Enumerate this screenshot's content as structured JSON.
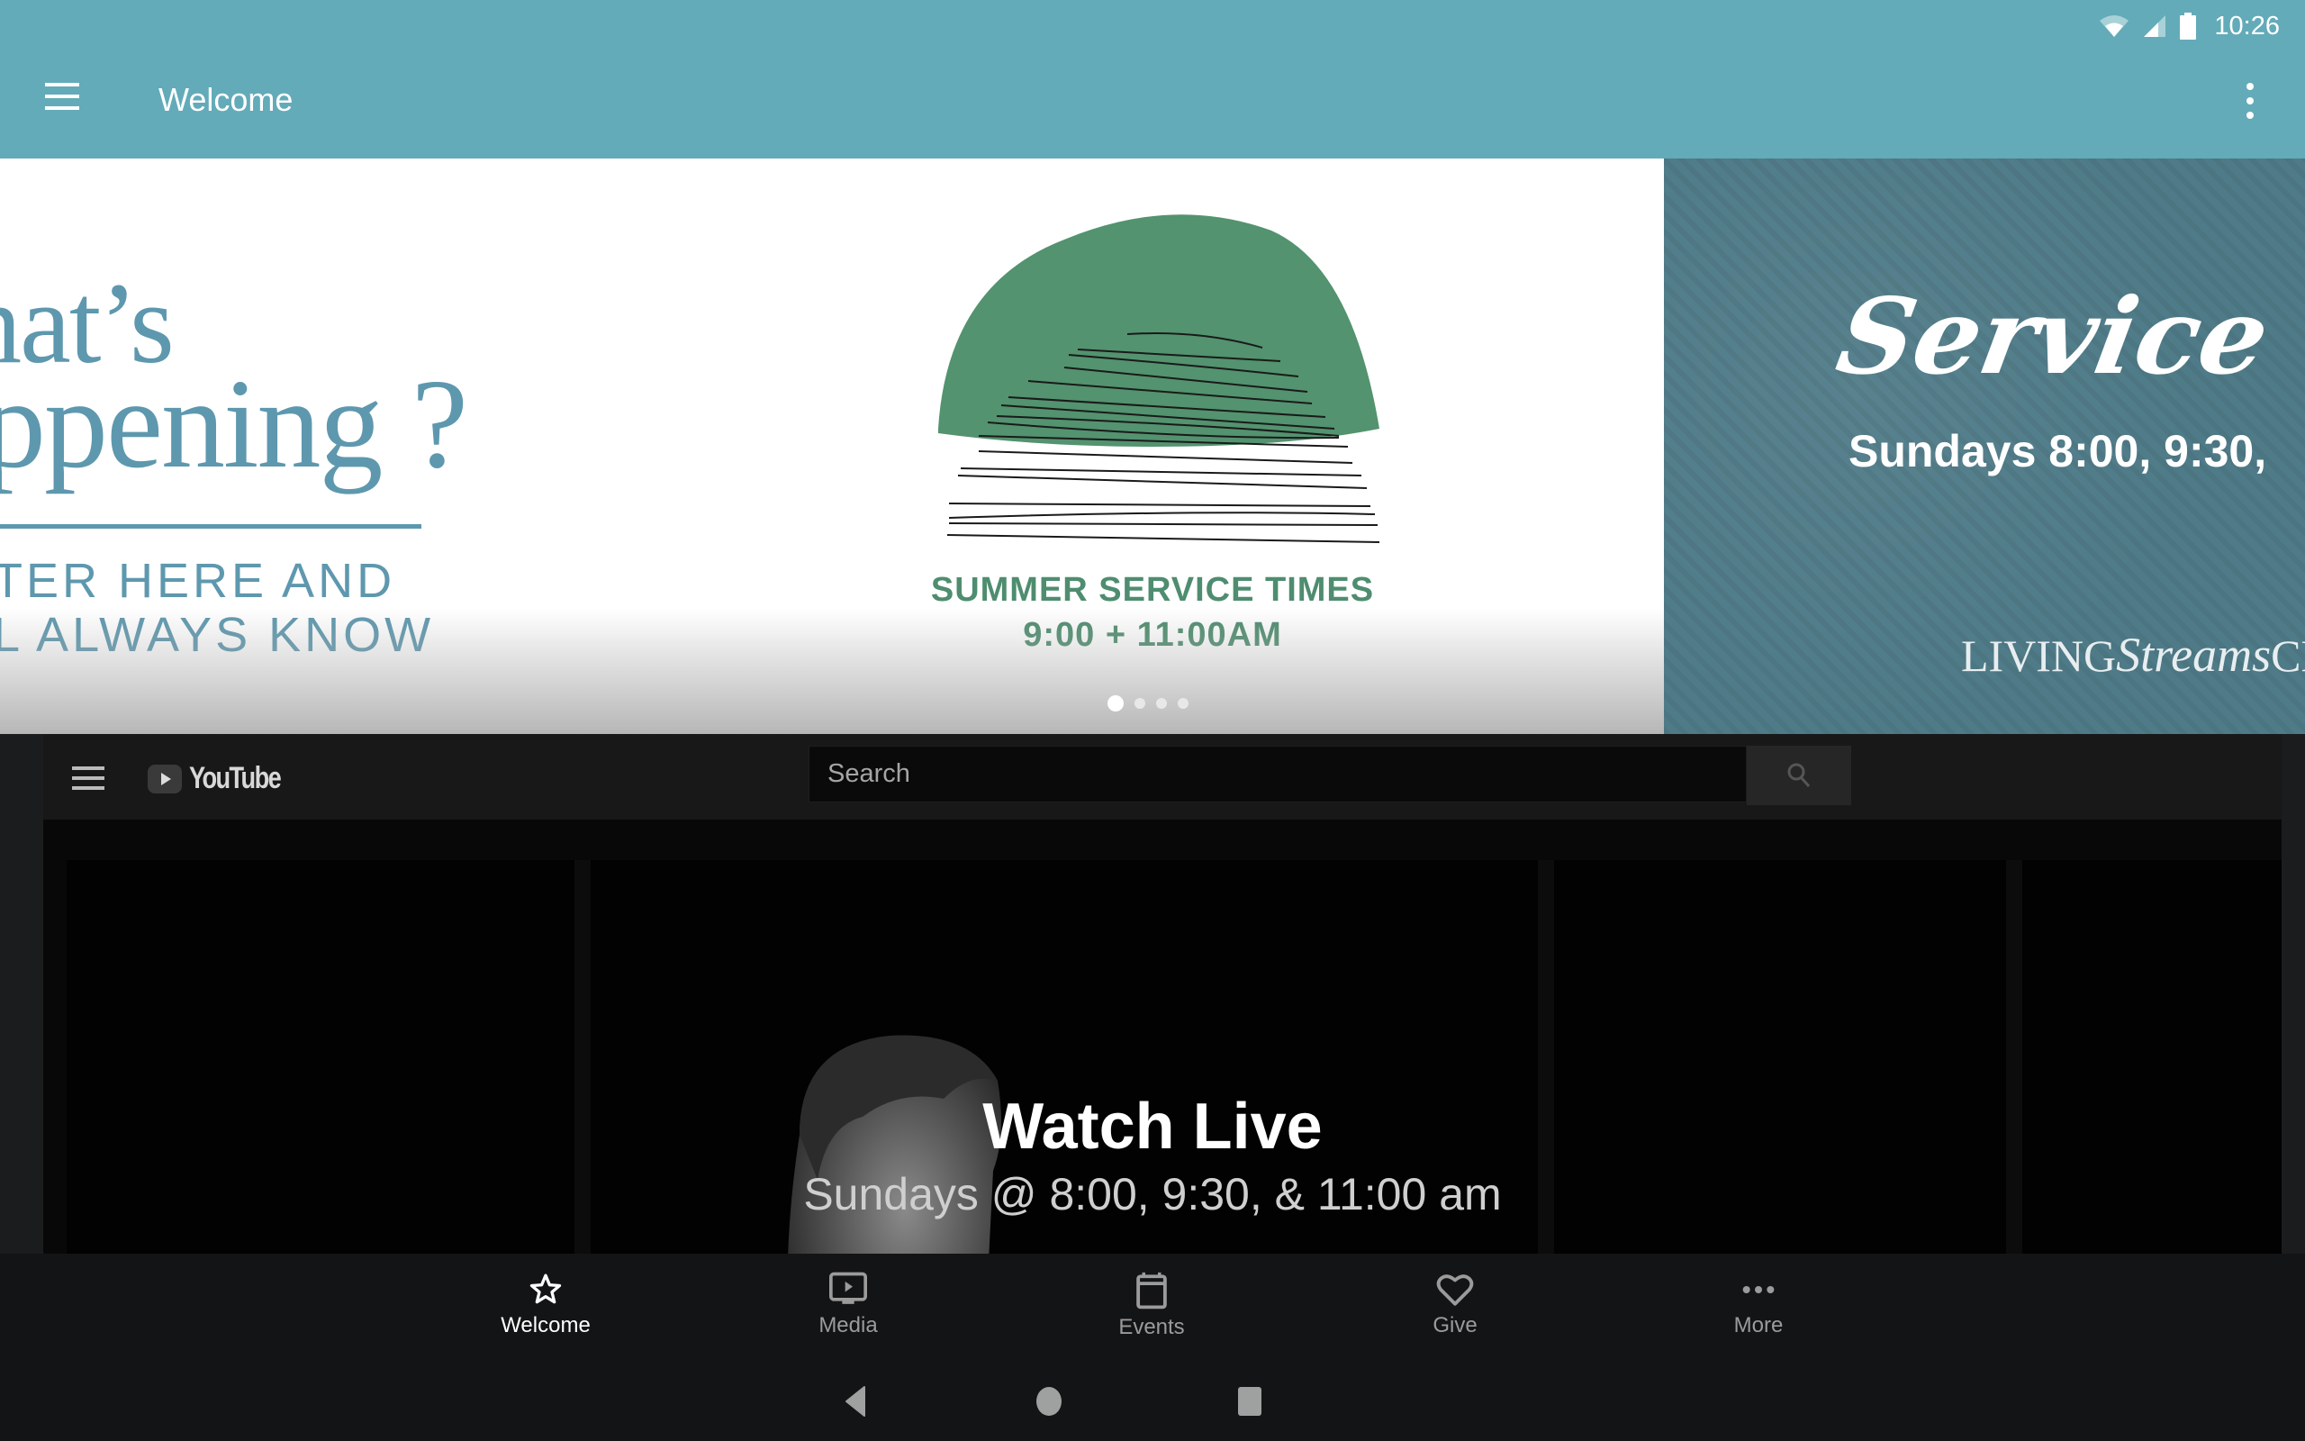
{
  "status_bar": {
    "time": "10:26",
    "icons": [
      "wifi-icon",
      "cell-signal-icon",
      "battery-icon"
    ]
  },
  "app_bar": {
    "menu_icon": "hamburger-menu-icon",
    "title": "Welcome",
    "overflow_icon": "more-vert-icon"
  },
  "carousel": {
    "active_index": 0,
    "page_count": 4,
    "slides": [
      {
        "line1": "hat’s",
        "line2": "ppening ?",
        "line3": "TER HERE AND",
        "line4": "L ALWAYS KNOW"
      },
      {
        "heading": "SUMMER SERVICE TIMES",
        "times": "9:00  +  11:00AM"
      },
      {
        "script_title": "Service T",
        "times": "Sundays 8:00, 9:30,",
        "logo_prefix": "LIVING",
        "logo_script": "Streams",
        "logo_suffix": "CHU"
      }
    ],
    "colors": {
      "slate_blue": "#5e98ae",
      "green": "#4e8d6f",
      "teal_bg": "#4f7b88"
    }
  },
  "youtube_embed": {
    "logo_text": "YouTube",
    "search_placeholder": "Search",
    "video_title": "Watch Live",
    "video_subtitle": "Sundays @ 8:00, 9:30, & 11:00 am"
  },
  "bottom_nav": {
    "items": [
      {
        "label": "Welcome",
        "icon": "star-icon",
        "active": true
      },
      {
        "label": "Media",
        "icon": "media-play-icon",
        "active": false
      },
      {
        "label": "Events",
        "icon": "calendar-icon",
        "active": false
      },
      {
        "label": "Give",
        "icon": "heart-icon",
        "active": false
      },
      {
        "label": "More",
        "icon": "more-horiz-icon",
        "active": false
      }
    ]
  },
  "system_nav": {
    "buttons": [
      "back",
      "home",
      "recents"
    ]
  },
  "theme": {
    "primary": "#63abb9",
    "nav_bg": "#131416",
    "inactive": "#9b9b9b"
  }
}
